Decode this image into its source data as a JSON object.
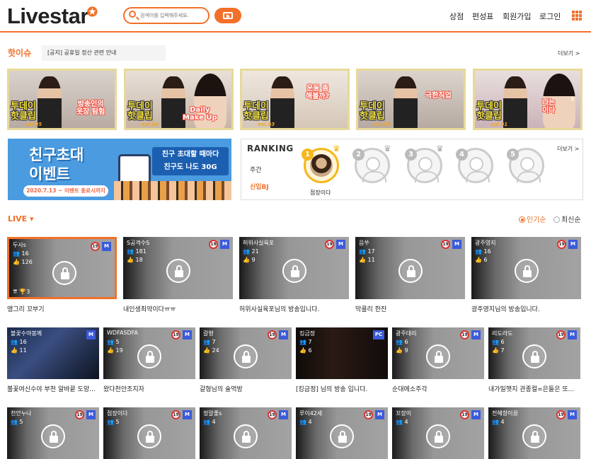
{
  "header": {
    "logo": "Livestar",
    "logo_star": "✪",
    "search_placeholder": "검색어를 입력해주세요.",
    "nav": [
      "상점",
      "편성표",
      "회원가입",
      "로그인"
    ]
  },
  "hot": {
    "title": "핫이슈",
    "notice": "[공지]  공휴일 정산 관련 안내",
    "more": "더보기 >",
    "clips": [
      {
        "title": "투데이\n핫클립",
        "vol": "vol.95",
        "sub": "방송인의\n옷장 탐험"
      },
      {
        "title": "투데이\n핫클립",
        "vol": "vol.94",
        "sub": "Daily\nMake Up"
      },
      {
        "title": "투데이\n핫클립",
        "vol": "vol.93",
        "sub": "운동 좀\n해볼까?"
      },
      {
        "title": "투데이\n핫클립",
        "vol": "vol.92",
        "sub": "극한직업"
      },
      {
        "title": "투데이\n핫클립",
        "vol": "vol.91",
        "sub": "나는\n이다"
      }
    ]
  },
  "banner": {
    "title": "친구초대\n이벤트",
    "side": "친구 초대할 때마다\n친구도 나도 30G",
    "date": "2020.7.13 ~ 이벤트 종료시까지"
  },
  "ranking": {
    "title": "RANKING",
    "more": "더보기 >",
    "weekly": "주간",
    "new_bj": "신입BJ",
    "top_name": "점장이다",
    "ranks": [
      "1",
      "2",
      "3",
      "4",
      "5"
    ]
  },
  "live": {
    "label": "LIVE ▾",
    "sort_popular": "인기순",
    "sort_latest": "최신순",
    "rows": [
      [
        {
          "name": "두사s",
          "viewers": "16",
          "likes": "126",
          "caption": "앵그리 꼬부기",
          "rank": "3",
          "badge": "M"
        },
        {
          "name": "S공격수S",
          "viewers": "181",
          "likes": "18",
          "caption": "내인생최악이다ㅠㅠ",
          "badge": "M"
        },
        {
          "name": "허위사실육포",
          "viewers": "21",
          "likes": "9",
          "caption": "허위사실육포님의 방송입니다.",
          "badge": "M"
        },
        {
          "name": "음쑤",
          "viewers": "17",
          "likes": "11",
          "caption": "막콜리 한잔",
          "badge": "M"
        },
        {
          "name": "광주영지",
          "viewers": "16",
          "likes": "6",
          "caption": "광주영지님의 방송입니다.",
          "badge": "M"
        }
      ],
      [
        {
          "name": "불꽃수야봉께",
          "viewers": "16",
          "likes": "11",
          "caption": "불꽃여신수야 부천 알바끝 도망...",
          "badge": "M"
        },
        {
          "name": "WDFASDFA",
          "viewers": "5",
          "likes": "19",
          "caption": "왔다천안조지자",
          "badge": "M"
        },
        {
          "name": "갈형",
          "viewers": "7",
          "likes": "24",
          "caption": "갈형님의 술먹방",
          "badge": "M"
        },
        {
          "name": "킹금정",
          "viewers": "7",
          "likes": "6",
          "caption": "[킹금정] 님의 방송 입니다.",
          "badge": "PC"
        },
        {
          "name": "광주대리",
          "viewers": "6",
          "likes": "9",
          "caption": "순대에소주각",
          "badge": "M"
        },
        {
          "name": "리도라도",
          "viewers": "6",
          "likes": "7",
          "caption": "내가밀햇지 관종컬=은들은 또...",
          "badge": "M"
        }
      ],
      [
        {
          "name": "천안누나",
          "viewers": "5",
          "badge": "M"
        },
        {
          "name": "점장이다",
          "viewers": "5",
          "badge": "M"
        },
        {
          "name": "정말좋s",
          "viewers": "4",
          "badge": "M"
        },
        {
          "name": "루이42세",
          "viewers": "4",
          "badge": "M"
        },
        {
          "name": "꼬장이",
          "viewers": "4",
          "badge": "M"
        },
        {
          "name": "전혜향이꿈",
          "viewers": "4",
          "badge": "M"
        }
      ]
    ]
  },
  "colors": {
    "accent": "#f27029",
    "badge_blue": "#3b5bdb",
    "badge_red": "#d33333"
  }
}
